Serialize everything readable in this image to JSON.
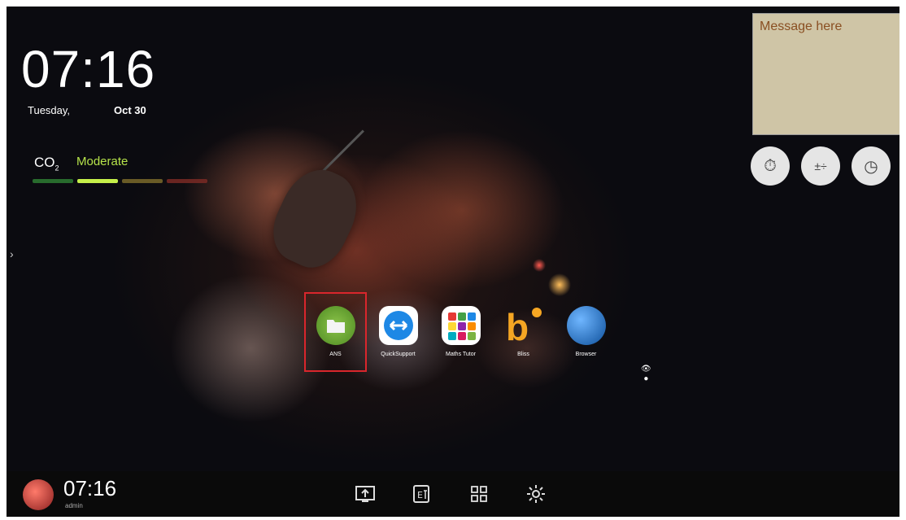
{
  "clock": {
    "time": "07:16",
    "day": "Tuesday,",
    "date": "Oct 30"
  },
  "co2": {
    "label": "CO",
    "sub": "2",
    "status": "Moderate",
    "levels": [
      {
        "color": "#2e7d32",
        "active": false
      },
      {
        "color": "#c6f04a",
        "active": true
      },
      {
        "color": "#7a6a2a",
        "active": false
      },
      {
        "color": "#7a2a24",
        "active": false
      }
    ]
  },
  "note": {
    "text": "Message here",
    "color": "#cfc5a6"
  },
  "tools": [
    {
      "name": "stopwatch-icon",
      "glyph": "⏱"
    },
    {
      "name": "calculator-icon",
      "glyph": "±÷"
    },
    {
      "name": "timer-icon",
      "glyph": "◷"
    }
  ],
  "sidebar": {
    "arrow": "›"
  },
  "apps": [
    {
      "label": "ANS",
      "icon": "folder-icon",
      "color": "#6aa335",
      "selected": true
    },
    {
      "label": "QuickSupport",
      "icon": "quicksupport-icon",
      "color": "#1e88e5",
      "selected": false
    },
    {
      "label": "Maths Tutor",
      "icon": "maths-tutor-icon",
      "color": "#f4f4f4",
      "selected": false
    },
    {
      "label": "Bliss",
      "icon": "bliss-icon",
      "color": "#f5a623",
      "selected": false
    },
    {
      "label": "Browser",
      "icon": "globe-icon",
      "color": "#1e6fb8",
      "selected": false
    }
  ],
  "taskbar": {
    "time": "07:16",
    "user": "admin",
    "icons": [
      "screen-share-icon",
      "whiteboard-icon",
      "apps-grid-icon",
      "settings-icon"
    ]
  }
}
